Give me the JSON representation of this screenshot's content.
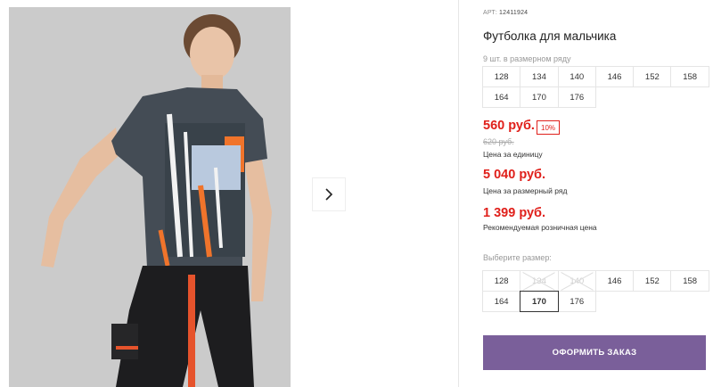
{
  "product": {
    "sku_label": "АРТ:",
    "sku": "12411924",
    "title": "Футболка для мальчика",
    "qty_in_row": "9 шт. в размерном ряду",
    "sizes_row": [
      "128",
      "134",
      "140",
      "146",
      "152",
      "158",
      "164",
      "170",
      "176"
    ],
    "price": "560 руб.",
    "discount": "10%",
    "old_price": "620 руб.",
    "price_note": "Цена за единицу",
    "row_price": "5 040 руб.",
    "row_price_note": "Цена за размерный ряд",
    "retail_price": "1 399 руб.",
    "retail_price_note": "Рекомендуемая розничная цена"
  },
  "size_selector": {
    "label": "Выберите размер:",
    "sizes": [
      {
        "label": "128",
        "state": "available"
      },
      {
        "label": "134",
        "state": "disabled"
      },
      {
        "label": "140",
        "state": "disabled"
      },
      {
        "label": "146",
        "state": "available"
      },
      {
        "label": "152",
        "state": "available"
      },
      {
        "label": "158",
        "state": "available"
      },
      {
        "label": "164",
        "state": "available"
      },
      {
        "label": "170",
        "state": "selected"
      },
      {
        "label": "176",
        "state": "available"
      }
    ]
  },
  "order_button": "ОФОРМИТЬ ЗАКАЗ",
  "colors": {
    "price": "#e0201b",
    "button": "#7a5f9a"
  }
}
